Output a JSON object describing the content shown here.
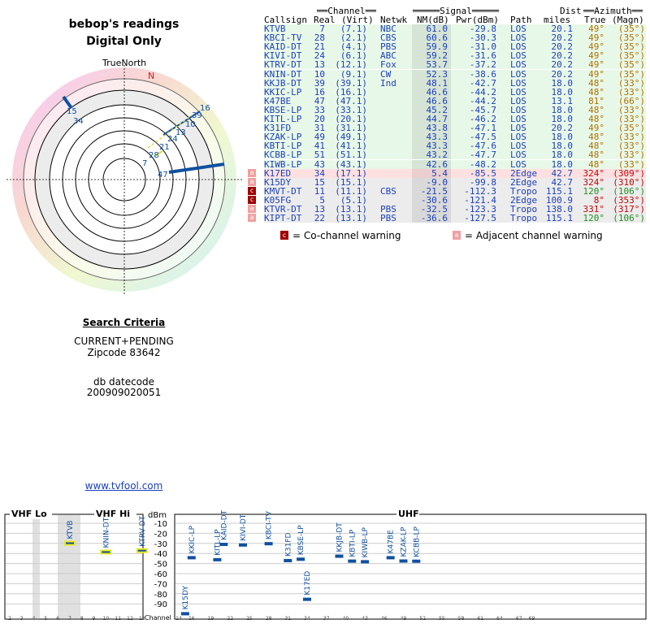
{
  "header": {
    "title": "bebop's readings",
    "subtitle": "Digital Only",
    "truenorth": "TrueNorth",
    "north": "N"
  },
  "criteria": {
    "heading": "Search Criteria",
    "line1": "CURRENT+PENDING",
    "line2": "Zipcode 83642",
    "db_label": "db datecode",
    "db_value": "200909020051",
    "link": "www.tvfool.com"
  },
  "table": {
    "group_channel": "Channel",
    "group_signal": "Signal",
    "group_dist": "Dist",
    "group_azimuth": "Azimuth",
    "col_callsign": "Callsign",
    "col_real": "Real",
    "col_virt": "(Virt)",
    "col_netwk": "Netwk",
    "col_nm": "NM(dB)",
    "col_pwr": "Pwr(dBm)",
    "col_path": "Path",
    "col_miles": "miles",
    "col_true": "True",
    "col_magn": "(Magn)",
    "rows": [
      {
        "call": "KTVB",
        "real": "7",
        "virt": "(7.1)",
        "net": "NBC",
        "nm": "61.0",
        "pwr": "-29.8",
        "path": "LOS",
        "dist": "20.1",
        "tru": "49°",
        "mag": "(35°)",
        "bg": "green",
        "warn": ""
      },
      {
        "call": "KBCI-TV",
        "real": "28",
        "virt": "(2.1)",
        "net": "CBS",
        "nm": "60.6",
        "pwr": "-30.3",
        "path": "LOS",
        "dist": "20.2",
        "tru": "49°",
        "mag": "(35°)",
        "bg": "green",
        "warn": ""
      },
      {
        "call": "KAID-DT",
        "real": "21",
        "virt": "(4.1)",
        "net": "PBS",
        "nm": "59.9",
        "pwr": "-31.0",
        "path": "LOS",
        "dist": "20.2",
        "tru": "49°",
        "mag": "(35°)",
        "bg": "green",
        "warn": ""
      },
      {
        "call": "KIVI-DT",
        "real": "24",
        "virt": "(6.1)",
        "net": "ABC",
        "nm": "59.2",
        "pwr": "-31.6",
        "path": "LOS",
        "dist": "20.2",
        "tru": "49°",
        "mag": "(35°)",
        "bg": "green",
        "warn": ""
      },
      {
        "call": "KTRV-DT",
        "real": "13",
        "virt": "(12.1)",
        "net": "Fox",
        "nm": "53.7",
        "pwr": "-37.2",
        "path": "LOS",
        "dist": "20.2",
        "tru": "49°",
        "mag": "(35°)",
        "bg": "green",
        "warn": ""
      },
      {
        "call": "KNIN-DT",
        "real": "10",
        "virt": "(9.1)",
        "net": "CW",
        "nm": "52.3",
        "pwr": "-38.6",
        "path": "LOS",
        "dist": "20.2",
        "tru": "49°",
        "mag": "(35°)",
        "bg": "green",
        "warn": ""
      },
      {
        "call": "KKJB-DT",
        "real": "39",
        "virt": "(39.1)",
        "net": "Ind",
        "nm": "48.1",
        "pwr": "-42.7",
        "path": "LOS",
        "dist": "18.0",
        "tru": "48°",
        "mag": "(33°)",
        "bg": "green",
        "warn": ""
      },
      {
        "call": "KKIC-LP",
        "real": "16",
        "virt": "(16.1)",
        "net": "",
        "nm": "46.6",
        "pwr": "-44.2",
        "path": "LOS",
        "dist": "18.0",
        "tru": "48°",
        "mag": "(33°)",
        "bg": "green",
        "warn": ""
      },
      {
        "call": "K47BE",
        "real": "47",
        "virt": "(47.1)",
        "net": "",
        "nm": "46.6",
        "pwr": "-44.2",
        "path": "LOS",
        "dist": "13.1",
        "tru": "81°",
        "mag": "(66°)",
        "bg": "green",
        "warn": ""
      },
      {
        "call": "KBSE-LP",
        "real": "33",
        "virt": "(33.1)",
        "net": "",
        "nm": "45.2",
        "pwr": "-45.7",
        "path": "LOS",
        "dist": "18.0",
        "tru": "48°",
        "mag": "(33°)",
        "bg": "green",
        "warn": ""
      },
      {
        "call": "KITL-LP",
        "real": "20",
        "virt": "(20.1)",
        "net": "",
        "nm": "44.7",
        "pwr": "-46.2",
        "path": "LOS",
        "dist": "18.0",
        "tru": "48°",
        "mag": "(33°)",
        "bg": "green",
        "warn": ""
      },
      {
        "call": "K31FD",
        "real": "31",
        "virt": "(31.1)",
        "net": "",
        "nm": "43.8",
        "pwr": "-47.1",
        "path": "LOS",
        "dist": "20.2",
        "tru": "49°",
        "mag": "(35°)",
        "bg": "green",
        "warn": ""
      },
      {
        "call": "KZAK-LP",
        "real": "49",
        "virt": "(49.1)",
        "net": "",
        "nm": "43.3",
        "pwr": "-47.5",
        "path": "LOS",
        "dist": "18.0",
        "tru": "48°",
        "mag": "(33°)",
        "bg": "green",
        "warn": ""
      },
      {
        "call": "KBTI-LP",
        "real": "41",
        "virt": "(41.1)",
        "net": "",
        "nm": "43.3",
        "pwr": "-47.6",
        "path": "LOS",
        "dist": "18.0",
        "tru": "48°",
        "mag": "(33°)",
        "bg": "green",
        "warn": ""
      },
      {
        "call": "KCBB-LP",
        "real": "51",
        "virt": "(51.1)",
        "net": "",
        "nm": "43.2",
        "pwr": "-47.7",
        "path": "LOS",
        "dist": "18.0",
        "tru": "48°",
        "mag": "(33°)",
        "bg": "green",
        "warn": ""
      },
      {
        "call": "KIWB-LP",
        "real": "43",
        "virt": "(43.1)",
        "net": "",
        "nm": "42.6",
        "pwr": "-48.2",
        "path": "LOS",
        "dist": "18.0",
        "tru": "48°",
        "mag": "(33°)",
        "bg": "green",
        "warn": ""
      },
      {
        "call": "K17ED",
        "real": "34",
        "virt": "(17.1)",
        "net": "",
        "nm": "5.4",
        "pwr": "-85.5",
        "path": "2Edge",
        "dist": "42.7",
        "tru": "324°",
        "mag": "(309°)",
        "bg": "red",
        "warn": "a"
      },
      {
        "call": "K15DY",
        "real": "15",
        "virt": "(15.1)",
        "net": "",
        "nm": "-9.0",
        "pwr": "-99.8",
        "path": "2Edge",
        "dist": "42.7",
        "tru": "324°",
        "mag": "(310°)",
        "bg": "gray",
        "warn": "a"
      },
      {
        "call": "KMVT-DT",
        "real": "11",
        "virt": "(11.1)",
        "net": "CBS",
        "nm": "-21.5",
        "pwr": "-112.3",
        "path": "Tropo",
        "dist": "115.1",
        "tru": "120°",
        "mag": "(106°)",
        "bg": "gray",
        "warn": "c"
      },
      {
        "call": "K05FG",
        "real": "5",
        "virt": "(5.1)",
        "net": "",
        "nm": "-30.6",
        "pwr": "-121.4",
        "path": "2Edge",
        "dist": "100.9",
        "tru": "8°",
        "mag": "(353°)",
        "bg": "gray",
        "warn": "c"
      },
      {
        "call": "KTVR-DT",
        "real": "13",
        "virt": "(13.1)",
        "net": "PBS",
        "nm": "-32.5",
        "pwr": "-123.3",
        "path": "Tropo",
        "dist": "138.0",
        "tru": "331°",
        "mag": "(317°)",
        "bg": "gray",
        "warn": "a"
      },
      {
        "call": "KIPT-DT",
        "real": "22",
        "virt": "(13.1)",
        "net": "PBS",
        "nm": "-36.6",
        "pwr": "-127.5",
        "path": "Tropo",
        "dist": "115.1",
        "tru": "120°",
        "mag": "(106°)",
        "bg": "gray",
        "warn": "a"
      }
    ],
    "warn_mark_c": "c",
    "warn_mark_a": "a",
    "legend_co": "= Co-channel warning",
    "legend_adj": "= Adjacent channel warning"
  },
  "colors": {
    "green_row": "#e8f8e8",
    "red_row": "#ffe0e0",
    "gray_row": "#ececec",
    "link": "#1a3fbf",
    "azimuth": "#b07000",
    "azimuth_red": "#cc0000",
    "trace": "#1050a0"
  },
  "chart_data": [
    {
      "type": "polar",
      "title": "bebop's readings",
      "north_label": "N",
      "stations": [
        {
          "label": "15",
          "azimuth": 324
        },
        {
          "label": "34",
          "azimuth": 324
        },
        {
          "label": "16",
          "azimuth": 48
        },
        {
          "label": "39",
          "azimuth": 48
        },
        {
          "label": "10",
          "azimuth": 49
        },
        {
          "label": "13",
          "azimuth": 49
        },
        {
          "label": "24",
          "azimuth": 49
        },
        {
          "label": "21",
          "azimuth": 49
        },
        {
          "label": "28",
          "azimuth": 49
        },
        {
          "label": "7",
          "azimuth": 49
        },
        {
          "label": "47",
          "azimuth": 81
        }
      ]
    },
    {
      "type": "bar",
      "ylabel": "dBm",
      "xlabel": "Channel",
      "sections": [
        "VHF Lo",
        "VHF Hi",
        "UHF"
      ],
      "y_ticks": [
        "-10",
        "-20",
        "-30",
        "-40",
        "-50",
        "-60",
        "-70",
        "-80",
        "-90"
      ],
      "x_ticks_vhf": [
        "2",
        "3",
        "4",
        "5",
        "6",
        "7",
        "8",
        "9",
        "10",
        "11",
        "12",
        "13"
      ],
      "x_ticks_uhf": [
        "14",
        "16",
        "19",
        "22",
        "25",
        "28",
        "31",
        "34",
        "37",
        "40",
        "43",
        "46",
        "49",
        "52",
        "55",
        "58",
        "61",
        "64",
        "67",
        "69"
      ],
      "ylim": [
        -100,
        -5
      ],
      "stations": [
        {
          "call": "KTVB",
          "channel": 7,
          "pwr": -29.8
        },
        {
          "call": "KNIN-DT",
          "channel": 10,
          "pwr": -38.6
        },
        {
          "call": "KTRV-DT",
          "channel": 13,
          "pwr": -37.2
        },
        {
          "call": "K15DY",
          "channel": 15,
          "pwr": -99.8
        },
        {
          "call": "KKIC-LP",
          "channel": 16,
          "pwr": -44.2
        },
        {
          "call": "KITL-LP",
          "channel": 20,
          "pwr": -46.2
        },
        {
          "call": "KAID-DT",
          "channel": 21,
          "pwr": -31.0
        },
        {
          "call": "KIVI-DT",
          "channel": 24,
          "pwr": -31.6
        },
        {
          "call": "KBCI-TV",
          "channel": 28,
          "pwr": -30.3
        },
        {
          "call": "K31FD",
          "channel": 31,
          "pwr": -47.1
        },
        {
          "call": "KBSE-LP",
          "channel": 33,
          "pwr": -45.7
        },
        {
          "call": "K17ED",
          "channel": 34,
          "pwr": -85.5
        },
        {
          "call": "KKJB-DT",
          "channel": 39,
          "pwr": -42.7
        },
        {
          "call": "KBTI-LP",
          "channel": 41,
          "pwr": -47.6
        },
        {
          "call": "KIWB-LP",
          "channel": 43,
          "pwr": -48.2
        },
        {
          "call": "K47BE",
          "channel": 47,
          "pwr": -44.2
        },
        {
          "call": "KZAK-LP",
          "channel": 49,
          "pwr": -47.5
        },
        {
          "call": "KCBB-LP",
          "channel": 51,
          "pwr": -47.7
        }
      ]
    }
  ]
}
